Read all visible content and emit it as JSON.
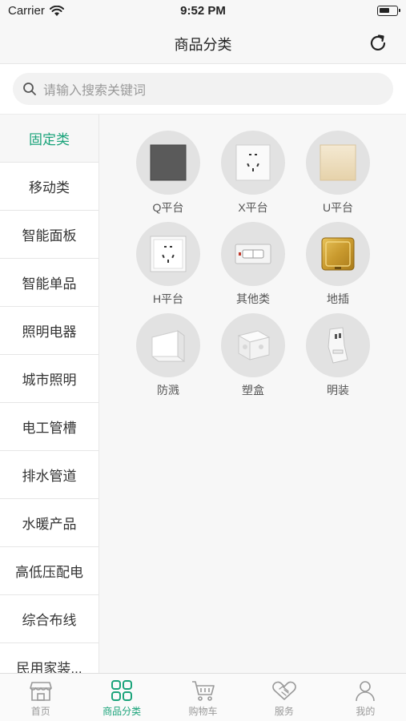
{
  "status_bar": {
    "carrier": "Carrier",
    "time": "9:52 PM"
  },
  "nav": {
    "title": "商品分类"
  },
  "search": {
    "placeholder": "请输入搜索关键词"
  },
  "sidebar": {
    "items": [
      {
        "label": "固定类",
        "active": true
      },
      {
        "label": "移动类"
      },
      {
        "label": "智能面板"
      },
      {
        "label": "智能单品"
      },
      {
        "label": "照明电器"
      },
      {
        "label": "城市照明"
      },
      {
        "label": "电工管槽"
      },
      {
        "label": "排水管道"
      },
      {
        "label": "水暖产品"
      },
      {
        "label": "高低压配电"
      },
      {
        "label": "综合布线"
      },
      {
        "label": "民用家装..."
      }
    ]
  },
  "grid": {
    "items": [
      {
        "label": "Q平台",
        "icon": "dark-panel-icon"
      },
      {
        "label": "X平台",
        "icon": "white-socket-icon"
      },
      {
        "label": "U平台",
        "icon": "gold-panel-icon"
      },
      {
        "label": "H平台",
        "icon": "framed-socket-icon"
      },
      {
        "label": "其他类",
        "icon": "switch-plate-icon"
      },
      {
        "label": "地插",
        "icon": "floor-socket-icon"
      },
      {
        "label": "防溅",
        "icon": "splash-cover-icon"
      },
      {
        "label": "塑盒",
        "icon": "plastic-box-icon"
      },
      {
        "label": "明装",
        "icon": "surface-socket-icon"
      }
    ]
  },
  "tab_bar": {
    "items": [
      {
        "label": "首页",
        "icon": "store-icon"
      },
      {
        "label": "商品分类",
        "icon": "grid-icon",
        "active": true
      },
      {
        "label": "购物车",
        "icon": "cart-icon"
      },
      {
        "label": "服务",
        "icon": "handshake-icon"
      },
      {
        "label": "我的",
        "icon": "user-icon"
      }
    ]
  },
  "colors": {
    "accent": "#1aa37a",
    "inactive": "#999999"
  }
}
